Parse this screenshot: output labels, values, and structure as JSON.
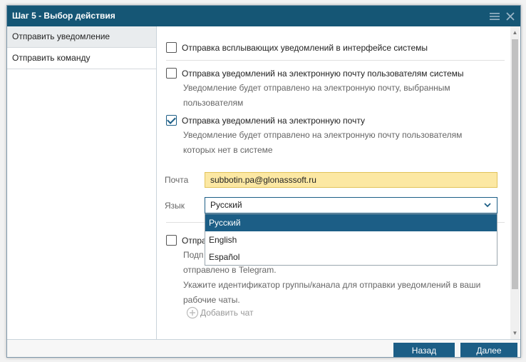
{
  "window": {
    "title": "Шаг 5 - Выбор действия"
  },
  "sidebar": {
    "items": [
      {
        "label": "Отправить уведомление",
        "active": true
      },
      {
        "label": "Отправить команду",
        "active": false
      }
    ]
  },
  "options": {
    "popup": {
      "label": "Отправка всплывающих уведомлений в интерфейсе системы",
      "checked": false
    },
    "user_email": {
      "label": "Отправка уведомлений на электронную почту пользователям системы",
      "desc_line1": "Уведомление будет отправлено на электронную почту, выбранным",
      "desc_line2": "пользователям",
      "checked": false
    },
    "external_email": {
      "label": "Отправка уведомлений на электронную почту",
      "desc_line1": "Уведомление будет отправлено на электронную почту пользователям",
      "desc_line2": "которых нет в системе",
      "checked": true
    },
    "telegram": {
      "label_visible": "Отпра",
      "desc_line1_visible": "Подп",
      "desc_line2_visible": "отправлено в Telegram.",
      "desc_line3": "Укажите идентификатор группы/канала для отправки уведомлений в ваши",
      "desc_line4": "рабочие чаты.",
      "checked": false
    }
  },
  "fields": {
    "email_label": "Почта",
    "email_value": "subbotin.pa@glonasssoft.ru",
    "language_label": "Язык",
    "language_value": "Русский",
    "language_options": [
      "Русский",
      "English",
      "Español"
    ],
    "language_selected_index": 0
  },
  "add_chat": {
    "label": "Добавить чат",
    "icon": "plus-circle-icon"
  },
  "footer": {
    "back_label": "Назад",
    "next_label": "Далее"
  },
  "colors": {
    "titlebar": "#155675",
    "accent": "#1c5e86",
    "email_bg": "#fce8a3",
    "sidebar_active": "#e9ecee"
  }
}
